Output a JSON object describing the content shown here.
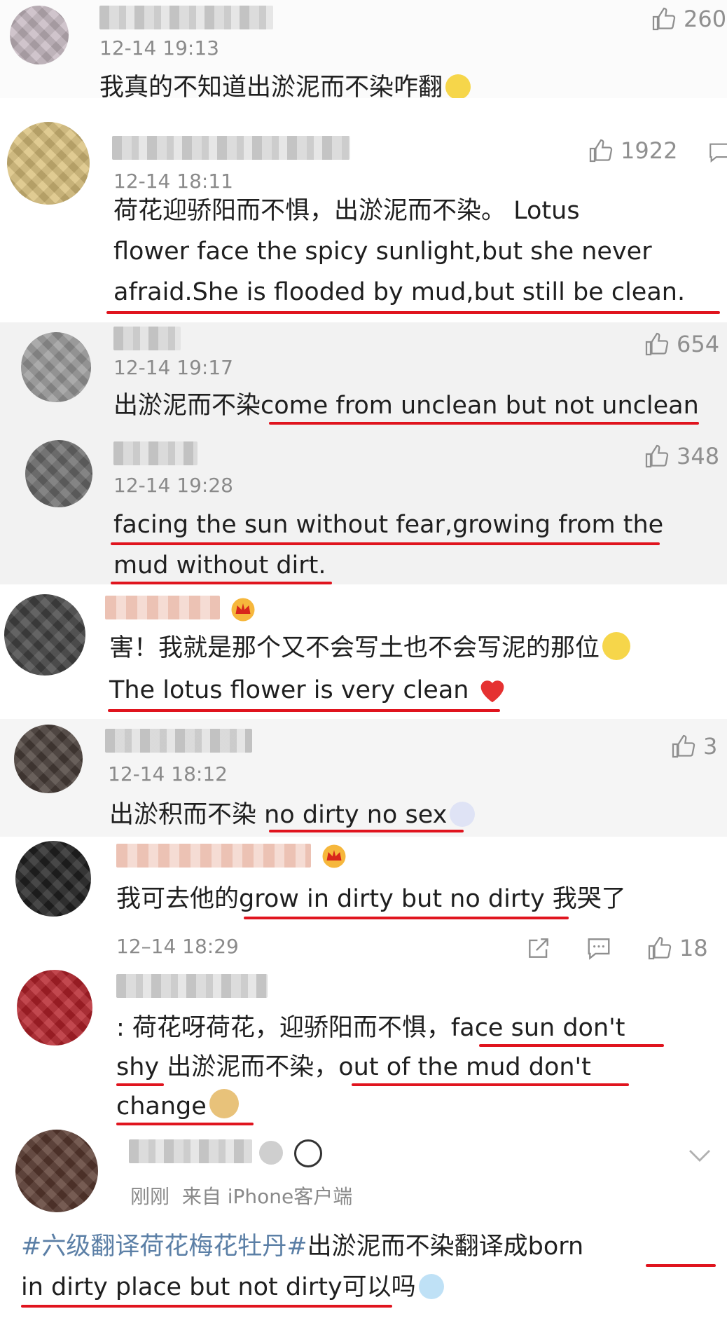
{
  "comments": [
    {
      "time": "12-14 19:13",
      "likes": "260",
      "lines": [
        "我真的不知道出淤泥而不染咋翻"
      ]
    },
    {
      "time": "12-14 18:11",
      "likes": "1922",
      "lines": [
        "荷花迎骄阳而不惧，出淤泥而不染。 Lotus",
        "flower face the spicy sunlight,but she never",
        "afraid.She is flooded by mud,but still be clean."
      ]
    },
    {
      "time": "12-14 19:17",
      "likes": "654",
      "lines": [
        "出淤泥而不染come from unclean but not unclean"
      ]
    },
    {
      "time": "12-14 19:28",
      "likes": "348",
      "lines": [
        "facing the sun without fear,growing from the",
        "mud without dirt."
      ]
    },
    {
      "time": "",
      "likes": "",
      "lines": [
        "害！我就是那个又不会写土也不会写泥的那位",
        "The lotus flower is very clean"
      ]
    },
    {
      "time": "12-14 18:12",
      "likes": "3",
      "lines": [
        "出淤积而不染 no dirty no sex"
      ]
    },
    {
      "time": "12–14 18:29",
      "likes": "18",
      "lines": [
        "我可去他的grow in dirty but no dirty 我哭了"
      ]
    },
    {
      "time": "",
      "likes": "",
      "lines": [
        ": 荷花呀荷花，迎骄阳而不惧，face sun don't",
        "shy 出淤泥而不染，out of the mud don't",
        "change"
      ]
    },
    {
      "time": "刚刚",
      "source": "来自 iPhone客户端",
      "likes": "",
      "hashtag": "#六级翻译荷花梅花牡丹#",
      "lines": [
        "出淤泥而不染翻译成born",
        "in dirty place but not dirty可以吗"
      ]
    }
  ],
  "colors": {
    "underline": "#e0141e",
    "hashtag": "#5b7fa6",
    "muted": "#8a8a8a"
  },
  "icons": [
    "thumbs-up-icon",
    "share-icon",
    "comment-icon",
    "crown-badge-icon",
    "chevron-down-icon",
    "smiley-emoji-icon",
    "heart-emoji-icon",
    "doge-emoji-icon"
  ]
}
